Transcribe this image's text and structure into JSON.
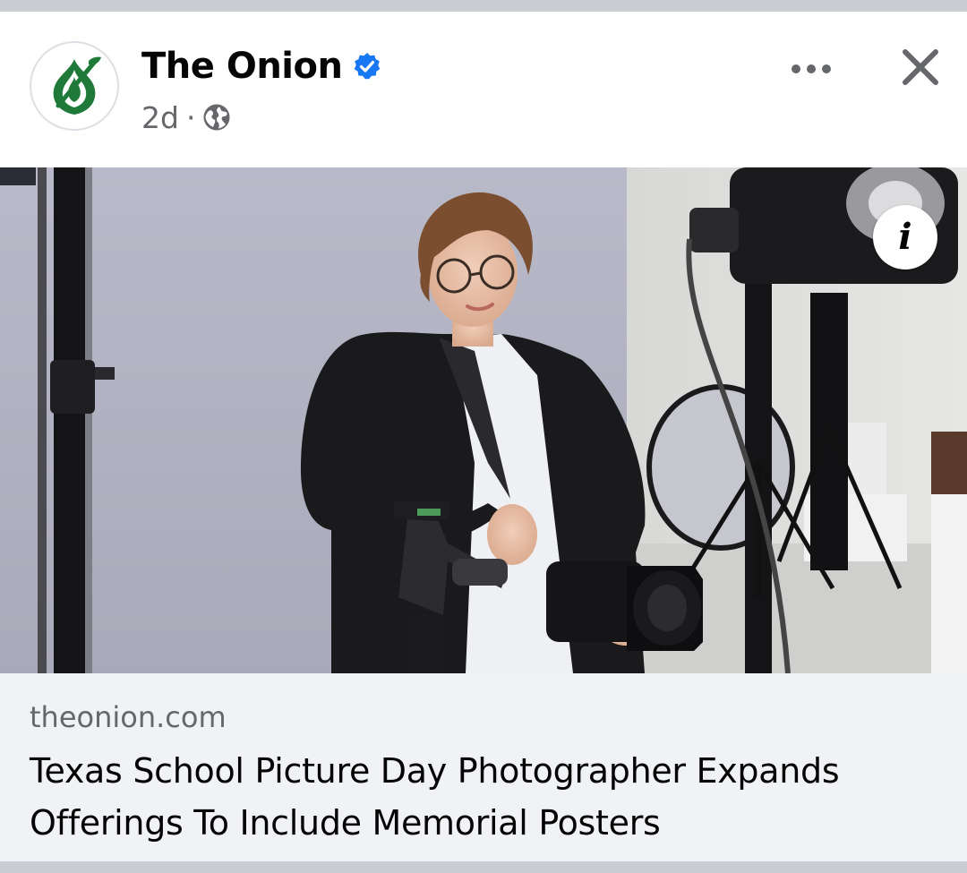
{
  "post": {
    "page_name": "The Onion",
    "verified": true,
    "timestamp": "2d",
    "separator": "·",
    "audience_icon": "globe-icon",
    "more_icon": "more-horizontal-icon",
    "close_icon": "close-icon"
  },
  "media": {
    "info_icon": "info-icon",
    "info_glyph": "i"
  },
  "link_preview": {
    "domain": "theonion.com",
    "title": "Texas School Picture Day Photographer Expands Offerings To Include Memorial Posters"
  },
  "colors": {
    "verified_blue": "#1877f2",
    "onion_green": "#1f7a3a",
    "secondary_text": "#65676b",
    "link_box_bg": "#f0f2f5"
  }
}
